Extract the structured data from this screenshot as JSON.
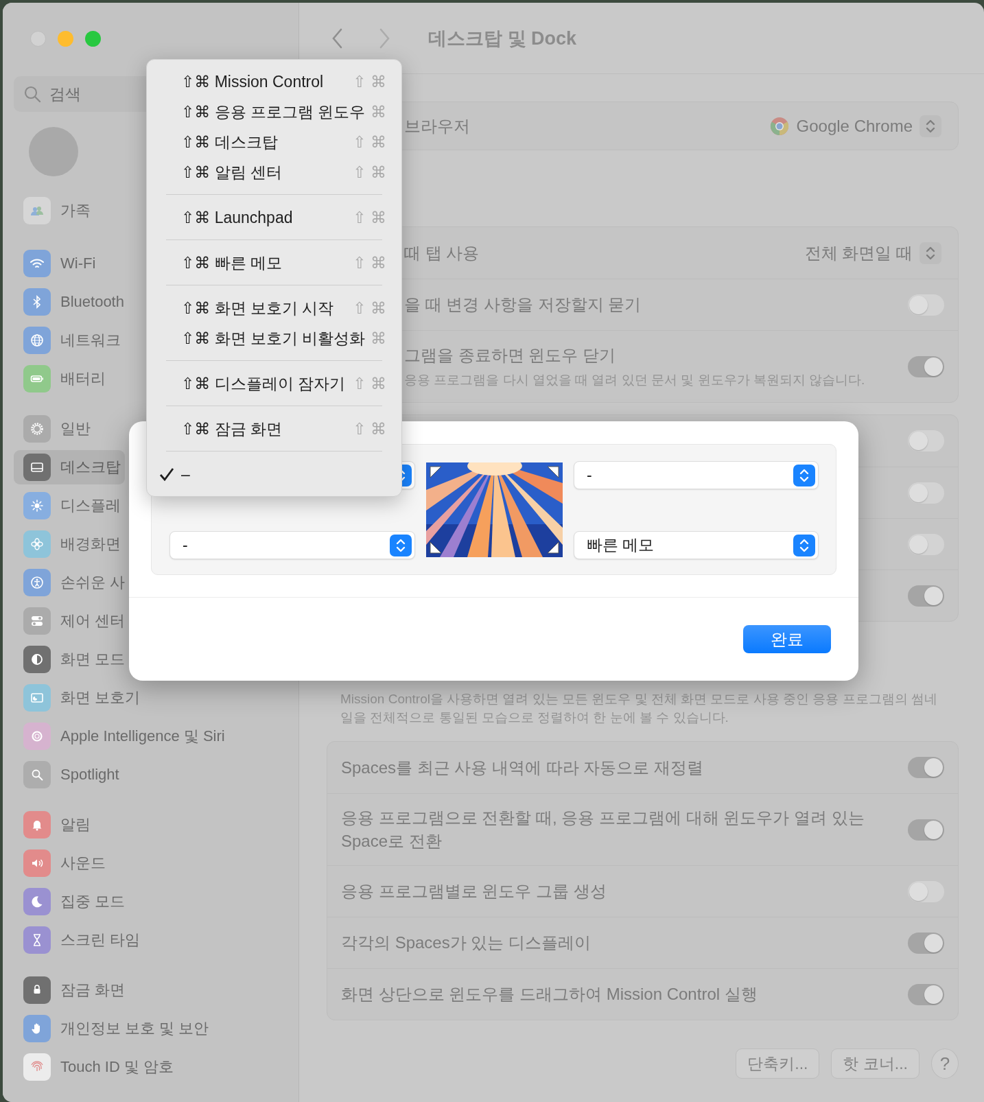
{
  "window": {
    "title": "데스크탑 및 Dock"
  },
  "sidebar": {
    "search": {
      "placeholder": "검색"
    },
    "groups": [
      {
        "items": [
          {
            "label": "가족",
            "selected": false
          }
        ]
      },
      {
        "items": [
          {
            "label": "Wi-Fi",
            "selected": false
          },
          {
            "label": "Bluetooth",
            "selected": false
          },
          {
            "label": "네트워크",
            "selected": false
          },
          {
            "label": "배터리",
            "selected": false
          }
        ]
      },
      {
        "items": [
          {
            "label": "일반",
            "selected": false
          },
          {
            "label": "데스크탑",
            "selected": true
          },
          {
            "label": "디스플레",
            "selected": false
          },
          {
            "label": "배경화면",
            "selected": false
          },
          {
            "label": "손쉬운 사",
            "selected": false
          },
          {
            "label": "제어 센터",
            "selected": false
          },
          {
            "label": "화면 모드",
            "selected": false
          },
          {
            "label": "화면 보호기",
            "selected": false
          },
          {
            "label": "Apple Intelligence 및 Siri",
            "selected": false
          },
          {
            "label": "Spotlight",
            "selected": false
          }
        ]
      },
      {
        "items": [
          {
            "label": "알림",
            "selected": false
          },
          {
            "label": "사운드",
            "selected": false
          },
          {
            "label": "집중 모드",
            "selected": false
          },
          {
            "label": "스크린 타임",
            "selected": false
          }
        ]
      },
      {
        "items": [
          {
            "label": "잠금 화면",
            "selected": false
          },
          {
            "label": "개인정보 보호 및 보안",
            "selected": false
          },
          {
            "label": "Touch ID 및 암호",
            "selected": false
          }
        ]
      }
    ]
  },
  "sections": [
    {
      "kind": "card",
      "rows": [
        {
          "kind": "app_popup",
          "label": "브라우저",
          "value": "Google Chrome"
        }
      ]
    },
    {
      "kind": "card",
      "rows": [
        {
          "kind": "popup",
          "label": "때 탭 사용",
          "value": "전체 화면일 때"
        },
        {
          "kind": "toggle",
          "label": "을 때 변경 사항을 저장할지 묻기",
          "on": false
        },
        {
          "kind": "toggle",
          "label": "그램을 종료하면 윈도우 닫기",
          "note": "응용 프로그램을 다시 열었을 때 열려 있던 문서 및 윈도우가 복원되지 않습니다.",
          "on": true
        }
      ]
    },
    {
      "kind": "card",
      "rows": [
        {
          "kind": "toggle",
          "on": false
        },
        {
          "kind": "toggle",
          "on": false
        },
        {
          "kind": "toggle",
          "on": false
        },
        {
          "kind": "toggle",
          "on": true
        }
      ]
    },
    {
      "kind": "note",
      "text": "Mission Control을 사용하면 열려 있는 모든 윈도우 및 전체 화면 모드로 사용 중인 응용 프로그램의 썸네일을 전체적으로 통일된 모습으로 정렬하여 한 눈에 볼 수 있습니다."
    },
    {
      "kind": "card",
      "rows": [
        {
          "kind": "toggle",
          "label": "Spaces를 최근 사용 내역에 따라 자동으로 재정렬",
          "on": true
        },
        {
          "kind": "toggle",
          "label": "응용 프로그램으로 전환할 때, 응용 프로그램에 대해 윈도우가 열려 있는 Space로 전환",
          "on": true
        },
        {
          "kind": "toggle",
          "label": "응용 프로그램별로 윈도우 그룹 생성",
          "on": false
        },
        {
          "kind": "toggle",
          "label": "각각의 Spaces가 있는 디스플레이",
          "on": true
        },
        {
          "kind": "toggle",
          "label": "화면 상단으로 윈도우를 드래그하여 Mission Control 실행",
          "on": true
        }
      ]
    }
  ],
  "buttons": [
    "단축키...",
    "핫 코너...",
    "?"
  ],
  "dialog": {
    "hot_corners": {
      "top_left": {
        "open": true
      },
      "top_right": {
        "value": "-"
      },
      "bottom_left": {
        "value": "-"
      },
      "bottom_right": {
        "value": "빠른 메모"
      }
    },
    "done_button": "완료"
  },
  "menu": {
    "groups": [
      [
        {
          "label": "⇧⌘ Mission Control",
          "shortcut": "⇧ ⌘",
          "checked": false
        },
        {
          "label": "⇧⌘ 응용 프로그램 윈도우",
          "shortcut": "⌘",
          "checked": false
        },
        {
          "label": "⇧⌘ 데스크탑",
          "shortcut": "⇧ ⌘",
          "checked": false
        },
        {
          "label": "⇧⌘ 알림 센터",
          "shortcut": "⇧ ⌘",
          "checked": false
        }
      ],
      [
        {
          "label": "⇧⌘ Launchpad",
          "shortcut": "⇧ ⌘",
          "checked": false
        }
      ],
      [
        {
          "label": "⇧⌘ 빠른 메모",
          "shortcut": "⇧ ⌘",
          "checked": false
        }
      ],
      [
        {
          "label": "⇧⌘ 화면 보호기 시작",
          "shortcut": "⇧ ⌘",
          "checked": false
        },
        {
          "label": "⇧⌘ 화면 보호기 비활성화",
          "shortcut": "⌘",
          "checked": false
        }
      ],
      [
        {
          "label": "⇧⌘ 디스플레이 잠자기",
          "shortcut": "⇧ ⌘",
          "checked": false
        }
      ],
      [
        {
          "label": "⇧⌘ 잠금 화면",
          "shortcut": "⇧ ⌘",
          "checked": false
        }
      ],
      [
        {
          "label": "–",
          "checked": true
        }
      ]
    ]
  }
}
